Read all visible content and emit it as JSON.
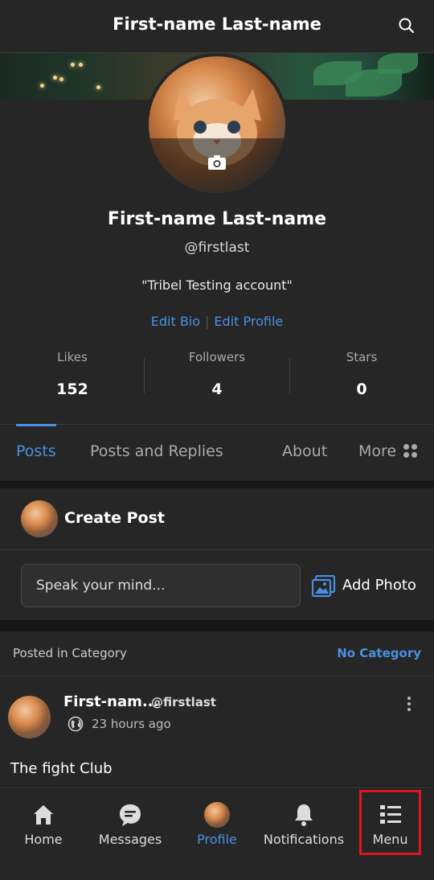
{
  "header": {
    "title": "First-name Last-name",
    "search_icon": "search-icon"
  },
  "profile": {
    "name": "First-name Last-name",
    "handle": "@firstlast",
    "bio": "\"Tribel Testing account\"",
    "edit_bio": "Edit Bio",
    "edit_profile": "Edit Profile",
    "separator": "|",
    "stats": [
      {
        "label": "Likes",
        "value": "152"
      },
      {
        "label": "Followers",
        "value": "4"
      },
      {
        "label": "Stars",
        "value": "0"
      }
    ]
  },
  "tabs": [
    {
      "label": "Posts",
      "active": true
    },
    {
      "label": "Posts and Replies",
      "active": false
    },
    {
      "label": "About",
      "active": false
    },
    {
      "label": "More",
      "active": false
    }
  ],
  "create_post": {
    "title": "Create Post",
    "placeholder": "Speak your mind...",
    "add_photo": "Add Photo"
  },
  "post": {
    "category_label": "Posted in Category",
    "category_value": "No Category",
    "author": "First-nam...",
    "handle": "@firstlast",
    "time": "23 hours ago",
    "text": "The fight Club"
  },
  "bottom_nav": [
    {
      "label": "Home",
      "icon": "home-icon",
      "active": false
    },
    {
      "label": "Messages",
      "icon": "messages-icon",
      "active": false
    },
    {
      "label": "Profile",
      "icon": "avatar",
      "active": true
    },
    {
      "label": "Notifications",
      "icon": "bell-icon",
      "active": false
    },
    {
      "label": "Menu",
      "icon": "menu-icon",
      "active": false
    }
  ],
  "colors": {
    "accent": "#4a90e2",
    "highlight": "#e0151f",
    "background": "#262626"
  }
}
